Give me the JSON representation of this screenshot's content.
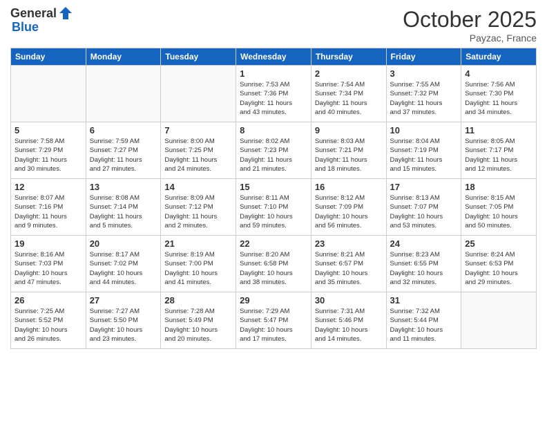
{
  "header": {
    "logo_general": "General",
    "logo_blue": "Blue",
    "month": "October 2025",
    "location": "Payzac, France"
  },
  "days_of_week": [
    "Sunday",
    "Monday",
    "Tuesday",
    "Wednesday",
    "Thursday",
    "Friday",
    "Saturday"
  ],
  "weeks": [
    [
      {
        "day": "",
        "info": ""
      },
      {
        "day": "",
        "info": ""
      },
      {
        "day": "",
        "info": ""
      },
      {
        "day": "1",
        "info": "Sunrise: 7:53 AM\nSunset: 7:36 PM\nDaylight: 11 hours\nand 43 minutes."
      },
      {
        "day": "2",
        "info": "Sunrise: 7:54 AM\nSunset: 7:34 PM\nDaylight: 11 hours\nand 40 minutes."
      },
      {
        "day": "3",
        "info": "Sunrise: 7:55 AM\nSunset: 7:32 PM\nDaylight: 11 hours\nand 37 minutes."
      },
      {
        "day": "4",
        "info": "Sunrise: 7:56 AM\nSunset: 7:30 PM\nDaylight: 11 hours\nand 34 minutes."
      }
    ],
    [
      {
        "day": "5",
        "info": "Sunrise: 7:58 AM\nSunset: 7:29 PM\nDaylight: 11 hours\nand 30 minutes."
      },
      {
        "day": "6",
        "info": "Sunrise: 7:59 AM\nSunset: 7:27 PM\nDaylight: 11 hours\nand 27 minutes."
      },
      {
        "day": "7",
        "info": "Sunrise: 8:00 AM\nSunset: 7:25 PM\nDaylight: 11 hours\nand 24 minutes."
      },
      {
        "day": "8",
        "info": "Sunrise: 8:02 AM\nSunset: 7:23 PM\nDaylight: 11 hours\nand 21 minutes."
      },
      {
        "day": "9",
        "info": "Sunrise: 8:03 AM\nSunset: 7:21 PM\nDaylight: 11 hours\nand 18 minutes."
      },
      {
        "day": "10",
        "info": "Sunrise: 8:04 AM\nSunset: 7:19 PM\nDaylight: 11 hours\nand 15 minutes."
      },
      {
        "day": "11",
        "info": "Sunrise: 8:05 AM\nSunset: 7:17 PM\nDaylight: 11 hours\nand 12 minutes."
      }
    ],
    [
      {
        "day": "12",
        "info": "Sunrise: 8:07 AM\nSunset: 7:16 PM\nDaylight: 11 hours\nand 9 minutes."
      },
      {
        "day": "13",
        "info": "Sunrise: 8:08 AM\nSunset: 7:14 PM\nDaylight: 11 hours\nand 5 minutes."
      },
      {
        "day": "14",
        "info": "Sunrise: 8:09 AM\nSunset: 7:12 PM\nDaylight: 11 hours\nand 2 minutes."
      },
      {
        "day": "15",
        "info": "Sunrise: 8:11 AM\nSunset: 7:10 PM\nDaylight: 10 hours\nand 59 minutes."
      },
      {
        "day": "16",
        "info": "Sunrise: 8:12 AM\nSunset: 7:09 PM\nDaylight: 10 hours\nand 56 minutes."
      },
      {
        "day": "17",
        "info": "Sunrise: 8:13 AM\nSunset: 7:07 PM\nDaylight: 10 hours\nand 53 minutes."
      },
      {
        "day": "18",
        "info": "Sunrise: 8:15 AM\nSunset: 7:05 PM\nDaylight: 10 hours\nand 50 minutes."
      }
    ],
    [
      {
        "day": "19",
        "info": "Sunrise: 8:16 AM\nSunset: 7:03 PM\nDaylight: 10 hours\nand 47 minutes."
      },
      {
        "day": "20",
        "info": "Sunrise: 8:17 AM\nSunset: 7:02 PM\nDaylight: 10 hours\nand 44 minutes."
      },
      {
        "day": "21",
        "info": "Sunrise: 8:19 AM\nSunset: 7:00 PM\nDaylight: 10 hours\nand 41 minutes."
      },
      {
        "day": "22",
        "info": "Sunrise: 8:20 AM\nSunset: 6:58 PM\nDaylight: 10 hours\nand 38 minutes."
      },
      {
        "day": "23",
        "info": "Sunrise: 8:21 AM\nSunset: 6:57 PM\nDaylight: 10 hours\nand 35 minutes."
      },
      {
        "day": "24",
        "info": "Sunrise: 8:23 AM\nSunset: 6:55 PM\nDaylight: 10 hours\nand 32 minutes."
      },
      {
        "day": "25",
        "info": "Sunrise: 8:24 AM\nSunset: 6:53 PM\nDaylight: 10 hours\nand 29 minutes."
      }
    ],
    [
      {
        "day": "26",
        "info": "Sunrise: 7:25 AM\nSunset: 5:52 PM\nDaylight: 10 hours\nand 26 minutes."
      },
      {
        "day": "27",
        "info": "Sunrise: 7:27 AM\nSunset: 5:50 PM\nDaylight: 10 hours\nand 23 minutes."
      },
      {
        "day": "28",
        "info": "Sunrise: 7:28 AM\nSunset: 5:49 PM\nDaylight: 10 hours\nand 20 minutes."
      },
      {
        "day": "29",
        "info": "Sunrise: 7:29 AM\nSunset: 5:47 PM\nDaylight: 10 hours\nand 17 minutes."
      },
      {
        "day": "30",
        "info": "Sunrise: 7:31 AM\nSunset: 5:46 PM\nDaylight: 10 hours\nand 14 minutes."
      },
      {
        "day": "31",
        "info": "Sunrise: 7:32 AM\nSunset: 5:44 PM\nDaylight: 10 hours\nand 11 minutes."
      },
      {
        "day": "",
        "info": ""
      }
    ]
  ]
}
